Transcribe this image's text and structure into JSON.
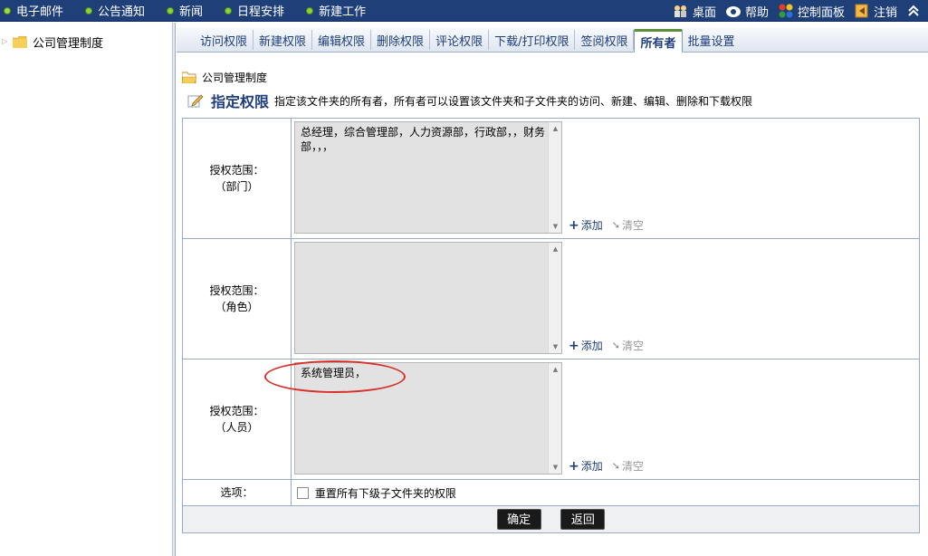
{
  "topbar": {
    "left_items": [
      "电子邮件",
      "公告通知",
      "新闻",
      "日程安排",
      "新建工作"
    ],
    "right_items": [
      {
        "label": "桌面",
        "icon": "desktop-icon"
      },
      {
        "label": "帮助",
        "icon": "help-icon"
      },
      {
        "label": "控制面板",
        "icon": "control-panel-icon"
      },
      {
        "label": "注销",
        "icon": "logout-icon"
      }
    ],
    "collapse_icon": "double-chevron-up-icon",
    "colors": {
      "bar": "#1f3f78",
      "dot": "#8bd43a"
    }
  },
  "tree": {
    "root_label": "公司管理制度",
    "icon": "folder-icon"
  },
  "tabs": [
    {
      "label": "访问权限",
      "active": false
    },
    {
      "label": "新建权限",
      "active": false
    },
    {
      "label": "编辑权限",
      "active": false
    },
    {
      "label": "删除权限",
      "active": false
    },
    {
      "label": "评论权限",
      "active": false
    },
    {
      "label": "下载/打印权限",
      "active": false
    },
    {
      "label": "签阅权限",
      "active": false
    },
    {
      "label": "所有者",
      "active": true
    },
    {
      "label": "批量设置",
      "active": false
    }
  ],
  "path": {
    "label": "公司管理制度"
  },
  "heading": {
    "title": "指定权限",
    "description": "指定该文件夹的所有者，所有者可以设置该文件夹和子文件夹的访问、新建、编辑、删除和下载权限"
  },
  "form": {
    "rows": [
      {
        "label_line1": "授权范围：",
        "label_line2": "（部门）",
        "value": "总经理，综合管理部，人力资源部，行政部，，财务部，，，"
      },
      {
        "label_line1": "授权范围：",
        "label_line2": "（角色）",
        "value": ""
      },
      {
        "label_line1": "授权范围：",
        "label_line2": "（人员）",
        "value": "系统管理员，"
      }
    ],
    "add_label": "添加",
    "clear_label": "清空",
    "option_label": "选项：",
    "option_checkbox_label": "重置所有下级子文件夹的权限",
    "option_checked": false,
    "confirm_label": "确定",
    "back_label": "返回"
  },
  "annotation": {
    "color": "#d8302a"
  }
}
